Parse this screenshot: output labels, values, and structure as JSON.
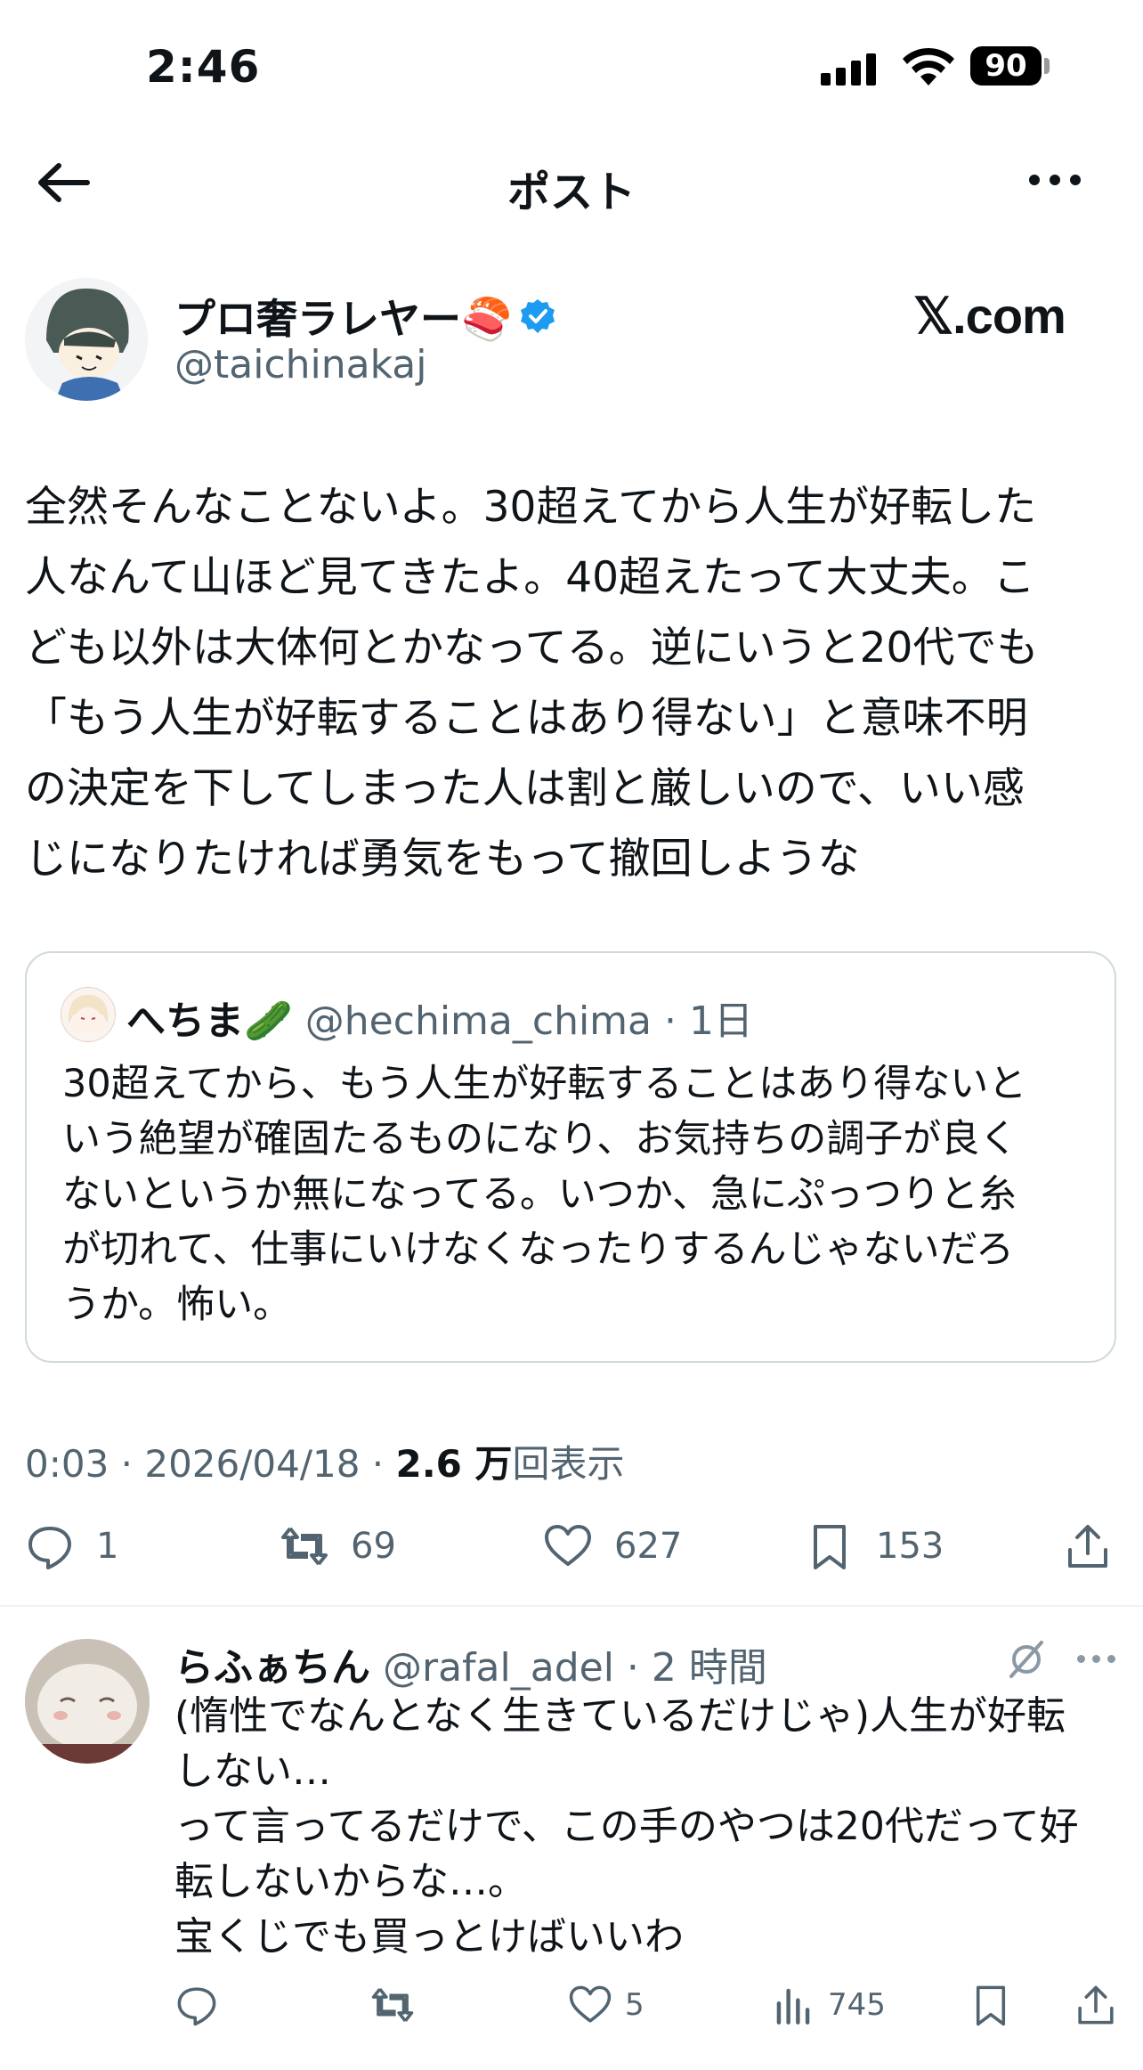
{
  "status_bar": {
    "time": "2:46",
    "battery": "90"
  },
  "nav": {
    "title": "ポスト"
  },
  "author": {
    "name": "プロ奢ラレヤー🍣",
    "handle": "@taichinakaj",
    "watermark": "𝕏.com"
  },
  "post": {
    "text": "全然そんなことないよ。30超えてから人生が好転した\n人なんて山ほど見てきたよ。40超えたって大丈夫。こ\nども以外は大体何とかなってる。逆にいうと20代でも\n「もう人生が好転することはあり得ない」と意味不明\nの決定を下してしまった人は割と厳しいので、いい感\nじになりたければ勇気をもって撤回しような"
  },
  "quote": {
    "name": "へちま🥒",
    "meta": "@hechima_chima · 1日",
    "text": "30超えてから、もう人生が好転することはあり得ないと\nいう絶望が確固たるものになり、お気持ちの調子が良く\nないというか無になってる。いつか、急にぷっつりと糸\nが切れて、仕事にいけなくなったりするんじゃないだろ\nうか。怖い。"
  },
  "meta": {
    "time_date": "0:03 · 2026/04/18 · ",
    "views": "2.6 万",
    "views_label": "回表示"
  },
  "actions": {
    "replies": "1",
    "reposts": "69",
    "likes": "627",
    "bookmarks": "153"
  },
  "reply": {
    "name": "らふぁちん",
    "meta": "@rafal_adel · 2 時間",
    "text": "(惰性でなんとなく生きているだけじゃ)人生が好転\nしない…\nって言ってるだけで、この手のやつは20代だって好\n転しないからな…。\n宝くじでも買っとけばいいわ",
    "likes": "5",
    "views": "745"
  }
}
